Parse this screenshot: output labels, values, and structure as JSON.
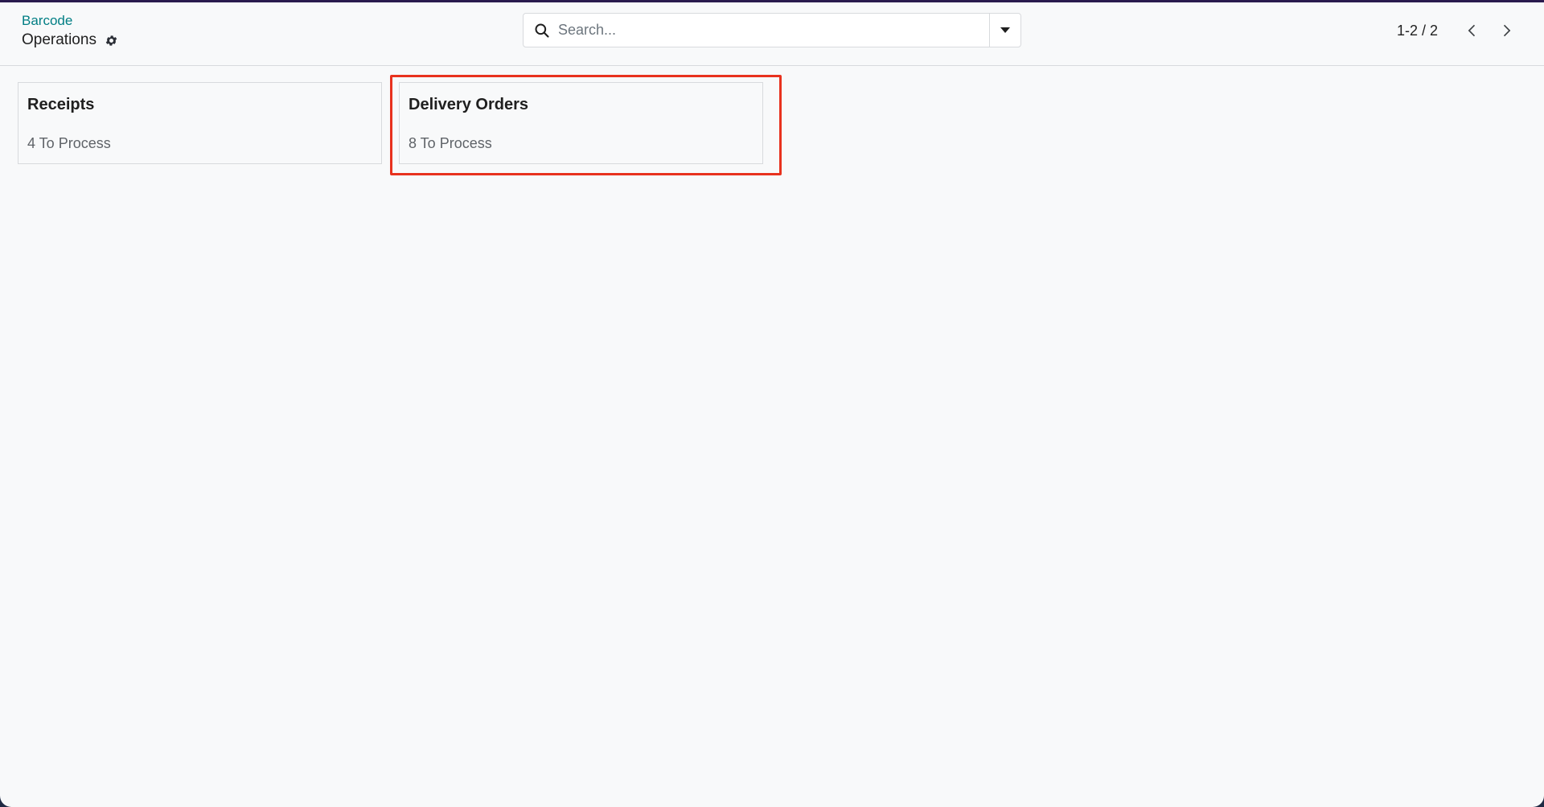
{
  "breadcrumb": {
    "parent": "Barcode",
    "current": "Operations"
  },
  "search": {
    "placeholder": "Search...",
    "value": ""
  },
  "pager": {
    "value": "1-2 / 2"
  },
  "cards": [
    {
      "title": "Receipts",
      "subtitle": "4 To Process"
    },
    {
      "title": "Delivery Orders",
      "subtitle": "8 To Process"
    }
  ],
  "icons": {
    "gear": "gear-icon",
    "search": "search-icon",
    "caret": "caret-down-icon",
    "prev": "chevron-left-icon",
    "next": "chevron-right-icon"
  },
  "colors": {
    "breadcrumb_link": "#017e84",
    "highlight": "#e8321e",
    "background": "#f8f9fa"
  }
}
